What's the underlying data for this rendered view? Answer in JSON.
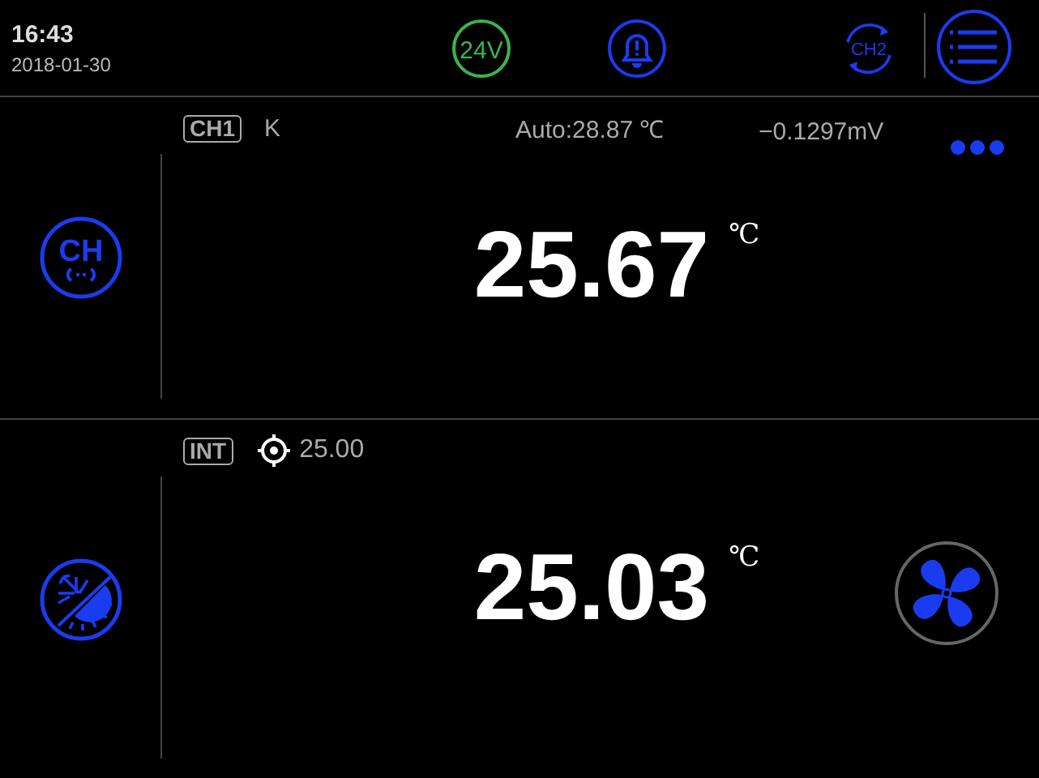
{
  "status_bar": {
    "time": "16:43",
    "date": "2018-01-30",
    "voltage": "24V",
    "channel_switch": "CH2"
  },
  "panels": [
    {
      "kind": "channel",
      "side_icon_text": "CH",
      "tag": "CH1",
      "type": "K",
      "auto": "Auto:28.87 ℃",
      "voltage": "−0.1297mV",
      "value": "25.67",
      "unit": "℃",
      "more": true
    },
    {
      "kind": "bath",
      "tag": "INT",
      "setpoint": "25.00",
      "value": "25.03",
      "unit": "℃",
      "fan": true
    }
  ]
}
